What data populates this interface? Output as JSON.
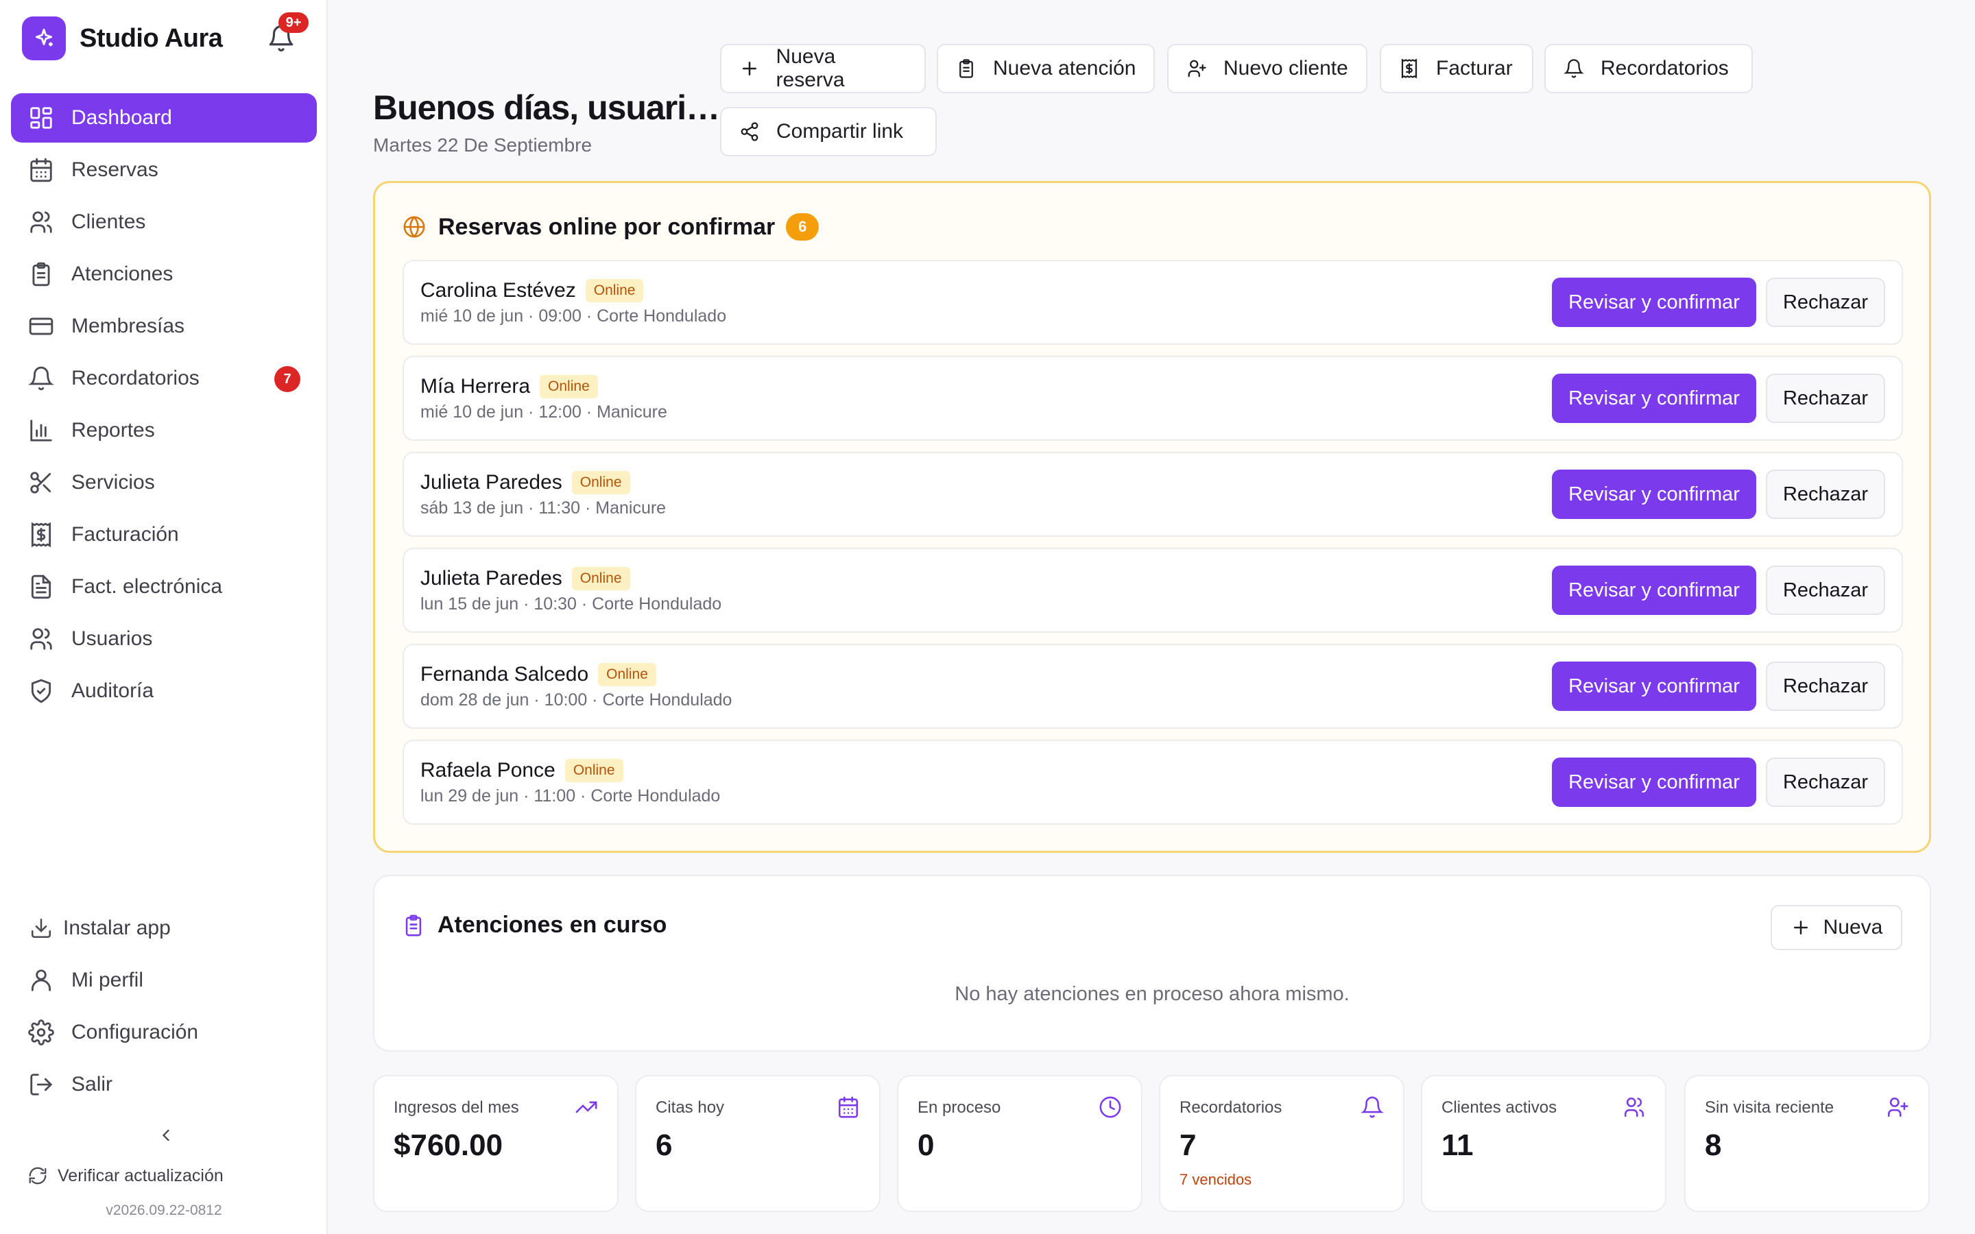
{
  "brand": {
    "name": "Studio Aura",
    "notifications_badge": "9+"
  },
  "sidebar": {
    "items": [
      {
        "label": "Dashboard",
        "icon": "dashboard-icon",
        "active": true
      },
      {
        "label": "Reservas",
        "icon": "calendar-icon"
      },
      {
        "label": "Clientes",
        "icon": "users-icon"
      },
      {
        "label": "Atenciones",
        "icon": "clipboard-icon"
      },
      {
        "label": "Membresías",
        "icon": "credit-card-icon"
      },
      {
        "label": "Recordatorios",
        "icon": "bell-icon",
        "badge": "7"
      },
      {
        "label": "Reportes",
        "icon": "bar-chart-icon"
      },
      {
        "label": "Servicios",
        "icon": "scissors-icon"
      },
      {
        "label": "Facturación",
        "icon": "receipt-icon"
      },
      {
        "label": "Fact. electrónica",
        "icon": "file-text-icon"
      },
      {
        "label": "Usuarios",
        "icon": "users-icon"
      },
      {
        "label": "Auditoría",
        "icon": "shield-check-icon"
      }
    ],
    "bottom": [
      {
        "label": "Instalar app",
        "icon": "download-icon"
      },
      {
        "label": "Mi perfil",
        "icon": "user-icon"
      },
      {
        "label": "Configuración",
        "icon": "gear-icon"
      },
      {
        "label": "Salir",
        "icon": "logout-icon"
      }
    ],
    "verify_label": "Verificar actualización",
    "version": "v2026.09.22-0812"
  },
  "header": {
    "greeting": "Buenos días, usuari…",
    "date": "Martes 22 De Septiembre",
    "actions": [
      {
        "label": "Nueva reserva",
        "icon": "plus-icon"
      },
      {
        "label": "Nueva atención",
        "icon": "clipboard-icon"
      },
      {
        "label": "Nuevo cliente",
        "icon": "user-plus-icon"
      },
      {
        "label": "Facturar",
        "icon": "receipt-icon"
      },
      {
        "label": "Recordatorios",
        "icon": "bell-icon"
      },
      {
        "label": "Compartir link",
        "icon": "share-icon"
      }
    ]
  },
  "pending": {
    "title": "Reservas online por confirmar",
    "count": "6",
    "online_label": "Online",
    "confirm_label": "Revisar y confirmar",
    "reject_label": "Rechazar",
    "reservations": [
      {
        "name": "Carolina Estévez",
        "detail": "mié 10 de jun · 09:00 · Corte Hondulado"
      },
      {
        "name": "Mía Herrera",
        "detail": "mié 10 de jun · 12:00 · Manicure"
      },
      {
        "name": "Julieta Paredes",
        "detail": "sáb 13 de jun · 11:30 · Manicure"
      },
      {
        "name": "Julieta Paredes",
        "detail": "lun 15 de jun · 10:30 · Corte Hondulado"
      },
      {
        "name": "Fernanda Salcedo",
        "detail": "dom 28 de jun · 10:00 · Corte Hondulado"
      },
      {
        "name": "Rafaela Ponce",
        "detail": "lun 29 de jun · 11:00 · Corte Hondulado"
      }
    ]
  },
  "in_progress": {
    "title": "Atenciones en curso",
    "new_label": "Nueva",
    "empty_text": "No hay atenciones en proceso ahora mismo."
  },
  "stats": [
    {
      "label": "Ingresos del mes",
      "value": "$760.00",
      "icon": "trending-up-icon"
    },
    {
      "label": "Citas hoy",
      "value": "6",
      "icon": "calendar-icon"
    },
    {
      "label": "En proceso",
      "value": "0",
      "icon": "clock-icon"
    },
    {
      "label": "Recordatorios",
      "value": "7",
      "sub": "7 vencidos",
      "icon": "bell-icon"
    },
    {
      "label": "Clientes activos",
      "value": "11",
      "icon": "users-icon"
    },
    {
      "label": "Sin visita reciente",
      "value": "8",
      "icon": "user-plus-icon"
    }
  ],
  "colors": {
    "accent": "#7c3aed",
    "badge_red": "#dc2626",
    "pending_border": "#f5d473",
    "count_badge": "#f59e0b",
    "warning_text": "#c2410c"
  }
}
